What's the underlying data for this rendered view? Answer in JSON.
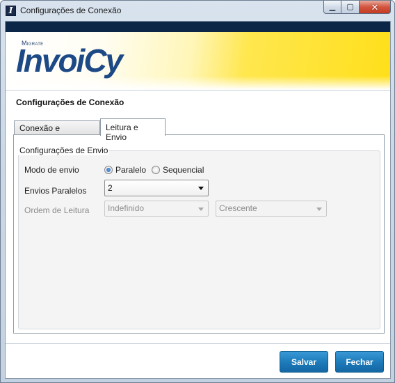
{
  "window": {
    "title": "Configurações de Conexão",
    "app_icon_glyph": "I",
    "caption_buttons": {
      "minimize": "▁",
      "maximize": "▢",
      "close": "✕"
    }
  },
  "banner": {
    "brand_small": "Migrate",
    "brand_main": "InvoiCy",
    "colors": {
      "navy": "#0c2648",
      "yellow": "#ffdf1a",
      "logo_blue": "#1d4a86"
    }
  },
  "section_title": "Configurações de Conexão",
  "tabs": [
    {
      "label": "Conexão e Ambiente",
      "selected": false
    },
    {
      "label": "Leitura e Envio",
      "selected": true
    }
  ],
  "group": {
    "title": "Configurações de Envio",
    "modo_envio": {
      "label": "Modo de envio",
      "options": [
        {
          "label": "Paralelo",
          "checked": true
        },
        {
          "label": "Sequencial",
          "checked": false
        }
      ]
    },
    "envios_paralelos": {
      "label": "Envios Paralelos",
      "value": "2"
    },
    "ordem_leitura": {
      "label": "Ordem de Leitura",
      "enabled": false,
      "field": "Indefinido",
      "direction": "Crescente"
    }
  },
  "buttons": {
    "save": "Salvar",
    "close": "Fechar",
    "color": "#1d79b8"
  }
}
